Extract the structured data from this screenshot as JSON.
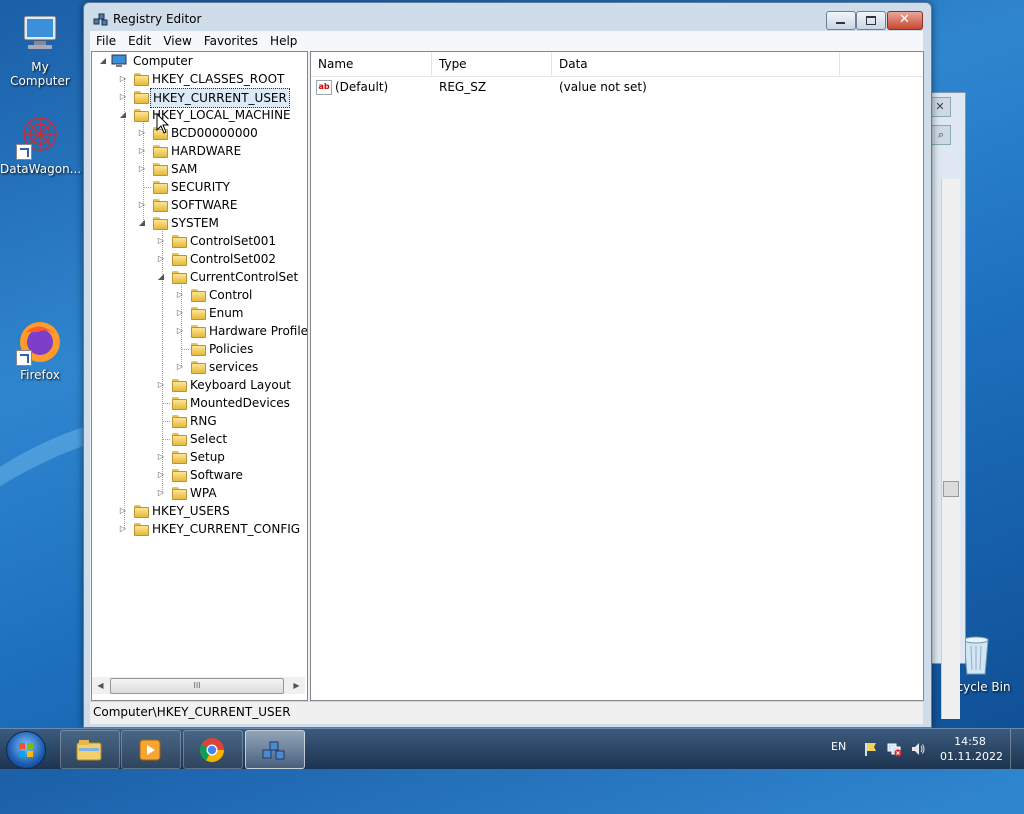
{
  "desktop": {
    "icons": [
      {
        "label": "My Computer",
        "icon": "computer-icon"
      },
      {
        "label": "DataWagon...",
        "icon": "datawagon-icon"
      },
      {
        "label": "Firefox",
        "icon": "firefox-icon"
      },
      {
        "label": "Recycle Bin",
        "icon": "recycle-bin-icon"
      }
    ]
  },
  "window": {
    "title": "Registry Editor",
    "menu": [
      "File",
      "Edit",
      "View",
      "Favorites",
      "Help"
    ],
    "tree": {
      "root": "Computer",
      "hives": {
        "classes_root": "HKEY_CLASSES_ROOT",
        "current_user": "HKEY_CURRENT_USER",
        "local_machine": "HKEY_LOCAL_MACHINE",
        "users": "HKEY_USERS",
        "current_config": "HKEY_CURRENT_CONFIG"
      },
      "local_machine_children": [
        "BCD00000000",
        "HARDWARE",
        "SAM",
        "SECURITY",
        "SOFTWARE",
        "SYSTEM"
      ],
      "system_children": [
        "ControlSet001",
        "ControlSet002",
        "CurrentControlSet",
        "Keyboard Layout",
        "MountedDevices",
        "RNG",
        "Select",
        "Setup",
        "Software",
        "WPA"
      ],
      "ccs_children": [
        "Control",
        "Enum",
        "Hardware Profiles",
        "Policies",
        "services"
      ],
      "hscroll_grip": "III"
    },
    "list": {
      "columns": [
        "Name",
        "Type",
        "Data"
      ],
      "rows": [
        {
          "icon": "ab",
          "name": "(Default)",
          "type": "REG_SZ",
          "data": "(value not set)"
        }
      ]
    },
    "status": "Computer\\HKEY_CURRENT_USER"
  },
  "taskbar": {
    "language": "EN",
    "time": "14:58",
    "date": "01.11.2022",
    "buttons": [
      "explorer-icon",
      "media-player-icon",
      "chrome-icon",
      "registry-editor-icon"
    ]
  },
  "colors": {
    "accent": "#2f86cf",
    "selection": "#dceaf8",
    "close_button": "#c6472f"
  }
}
